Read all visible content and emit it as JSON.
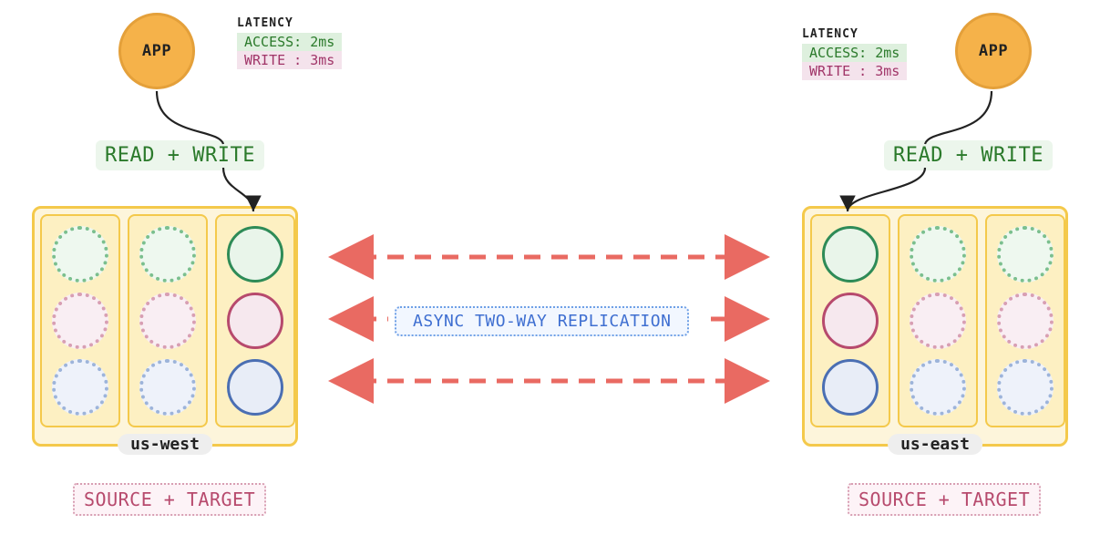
{
  "left": {
    "app_label": "APP",
    "latency_header": "LATENCY",
    "latency_access": "ACCESS: 2ms",
    "latency_write": "WRITE : 3ms",
    "rw_label": "READ + WRITE",
    "region_name": "us-west",
    "role_label": "SOURCE + TARGET"
  },
  "right": {
    "app_label": "APP",
    "latency_header": "LATENCY",
    "latency_access": "ACCESS: 2ms",
    "latency_write": "WRITE : 3ms",
    "rw_label": "READ + WRITE",
    "region_name": "us-east",
    "role_label": "SOURCE + TARGET"
  },
  "center": {
    "replication_label": "ASYNC TWO-WAY REPLICATION"
  },
  "diagram": {
    "nodes_per_region": 3,
    "shard_colors": [
      "green",
      "pink",
      "blue"
    ],
    "left_primary_column": 2,
    "right_primary_column": 0,
    "arrow_color": "#e96a62",
    "app_color": "#f5b24a"
  }
}
